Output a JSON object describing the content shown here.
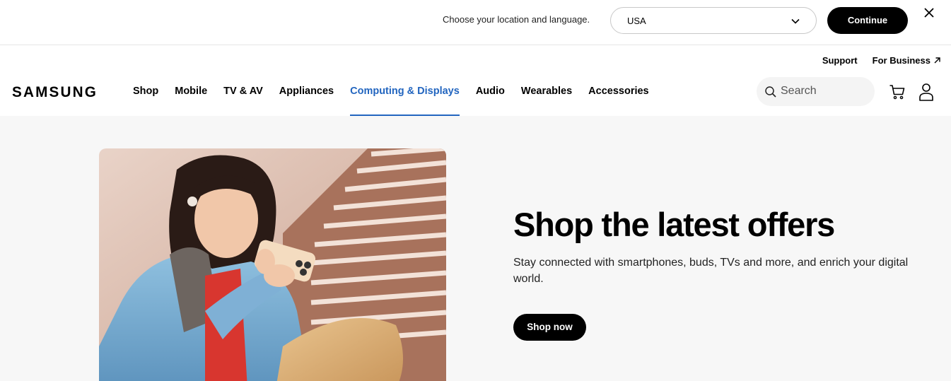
{
  "location_bar": {
    "prompt": "Choose your location and language.",
    "selected_country": "USA",
    "continue_label": "Continue"
  },
  "header": {
    "logo_text": "SAMSUNG",
    "utility_links": [
      "Support",
      "For Business"
    ],
    "nav": [
      "Shop",
      "Mobile",
      "TV & AV",
      "Appliances",
      "Computing & Displays",
      "Audio",
      "Wearables",
      "Accessories"
    ],
    "active_nav": "Computing & Displays",
    "search_placeholder": "Search"
  },
  "hero": {
    "title": "Shop the latest offers",
    "description": "Stay connected with smartphones, buds, TVs and more, and enrich your digital world.",
    "cta_label": "Shop now"
  },
  "colors": {
    "accent": "#2265bf",
    "hero_background": "#f7f7f7",
    "button_background": "#000000"
  }
}
